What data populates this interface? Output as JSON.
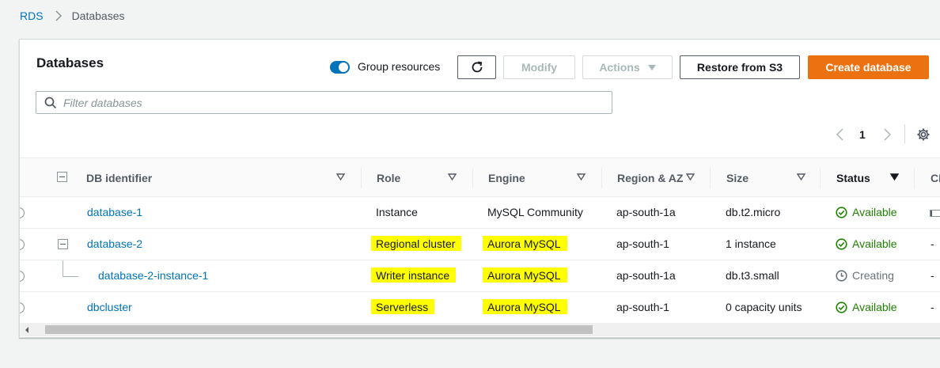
{
  "breadcrumb": {
    "root": "RDS",
    "current": "Databases"
  },
  "header": {
    "title": "Databases",
    "group_resources_label": "Group resources",
    "group_resources_on": true,
    "modify_label": "Modify",
    "actions_label": "Actions",
    "restore_label": "Restore from S3",
    "create_label": "Create database"
  },
  "search": {
    "placeholder": "Filter databases",
    "value": ""
  },
  "pagination": {
    "current_page": "1"
  },
  "columns": [
    "DB identifier",
    "Role",
    "Engine",
    "Region & AZ",
    "Size",
    "Status",
    "CP"
  ],
  "rows": [
    {
      "id": "database-1",
      "role": "Instance",
      "engine": "MySQL Community",
      "region": "ap-south-1a",
      "size": "db.t2.micro",
      "status": "Available",
      "cpu": ""
    },
    {
      "id": "database-2",
      "role": "Regional cluster",
      "engine": "Aurora MySQL",
      "region": "ap-south-1",
      "size": "1 instance",
      "status": "Available",
      "cpu": "-"
    },
    {
      "id": "database-2-instance-1",
      "role": "Writer instance",
      "engine": "Aurora MySQL",
      "region": "ap-south-1a",
      "size": "db.t3.small",
      "status": "Creating",
      "cpu": "-"
    },
    {
      "id": "dbcluster",
      "role": "Serverless",
      "engine": "Aurora MySQL",
      "region": "ap-south-1",
      "size": "0 capacity units",
      "status": "Available",
      "cpu": "-"
    }
  ],
  "colors": {
    "link": "#0073bb",
    "primary": "#ec7211",
    "available": "#1d8102",
    "highlight": "#ffff00"
  }
}
